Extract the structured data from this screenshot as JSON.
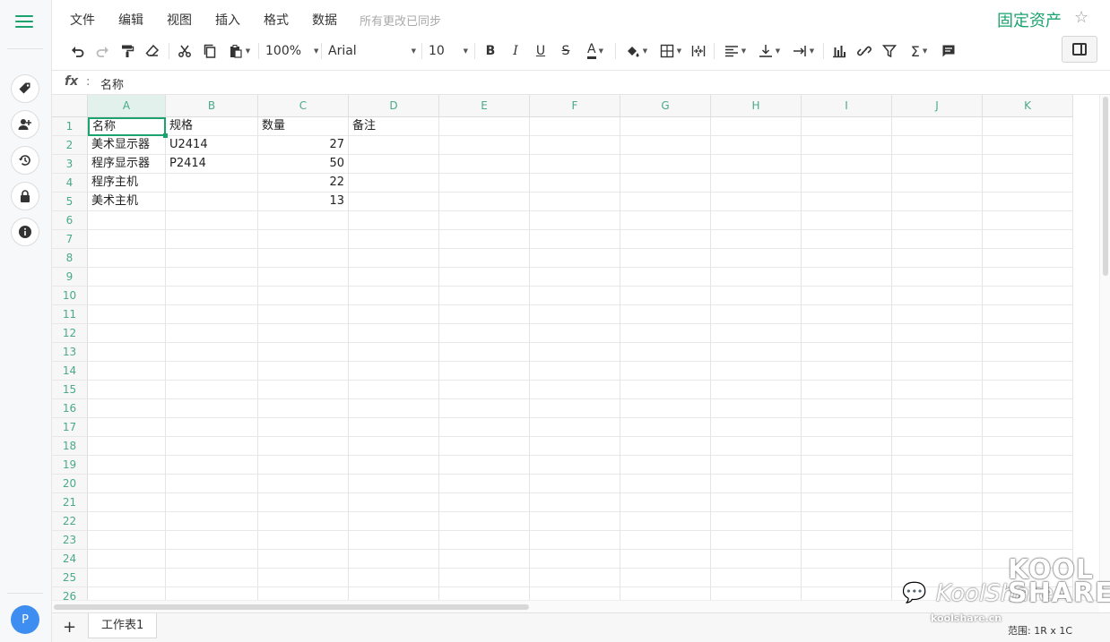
{
  "menu": {
    "items": [
      "文件",
      "编辑",
      "视图",
      "插入",
      "格式",
      "数据"
    ],
    "sync_status": "所有更改已同步"
  },
  "document": {
    "title": "固定资产"
  },
  "toolbar": {
    "zoom": "100%",
    "font": "Arial",
    "font_size": "10"
  },
  "formula_bar": {
    "label": "fx",
    "value": "名称"
  },
  "grid": {
    "columns": [
      "A",
      "B",
      "C",
      "D",
      "E",
      "F",
      "G",
      "H",
      "I",
      "J",
      "K"
    ],
    "selected_column": "A",
    "rows_visible": 26,
    "cells": [
      [
        "名称",
        "规格",
        "数量",
        "备注"
      ],
      [
        "美术显示器",
        "U2414",
        "27",
        ""
      ],
      [
        "程序显示器",
        "P2414",
        "50",
        ""
      ],
      [
        "程序主机",
        "",
        "22",
        ""
      ],
      [
        "美术主机",
        "",
        "13",
        ""
      ]
    ],
    "numeric_column": 2,
    "active_cell": "A1"
  },
  "sheet_tabs": [
    {
      "label": "工作表1"
    }
  ],
  "status": {
    "range": "范围: 1R x 1C"
  },
  "watermark": {
    "text": "KoolShare",
    "site": "koolshare.cn",
    "big": "KOOL SHARE"
  },
  "avatar": {
    "letter": "P",
    "color": "#3d8ef0"
  },
  "colors": {
    "accent": "#1aa36e"
  }
}
